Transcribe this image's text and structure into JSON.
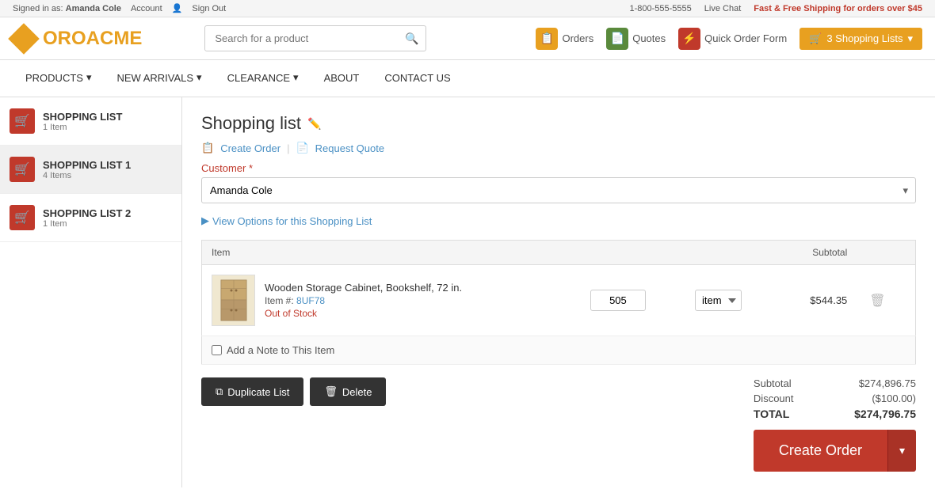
{
  "topbar": {
    "signed_in_label": "Signed in as:",
    "user_name": "Amanda Cole",
    "account_link": "Account",
    "sign_out_link": "Sign Out",
    "phone": "1-800-555-5555",
    "live_chat": "Live Chat",
    "promo": "Fast & Free Shipping for orders over $45"
  },
  "header": {
    "logo_text": "OROACME",
    "search_placeholder": "Search for a product",
    "actions": [
      {
        "id": "orders",
        "label": "Orders",
        "icon": "📋",
        "color": "orange"
      },
      {
        "id": "quotes",
        "label": "Quotes",
        "icon": "📄",
        "color": "green"
      },
      {
        "id": "quick-order",
        "label": "Quick Order Form",
        "icon": "⚡",
        "color": "red"
      }
    ],
    "shopping_lists_btn": "3 Shopping Lists"
  },
  "nav": {
    "items": [
      {
        "id": "products",
        "label": "PRODUCTS",
        "has_arrow": true
      },
      {
        "id": "new-arrivals",
        "label": "NEW ARRIVALS",
        "has_arrow": true
      },
      {
        "id": "clearance",
        "label": "CLEARANCE",
        "has_arrow": true
      },
      {
        "id": "about",
        "label": "ABOUT",
        "has_arrow": false
      },
      {
        "id": "contact-us",
        "label": "CONTACT US",
        "has_arrow": false
      }
    ]
  },
  "sidebar": {
    "items": [
      {
        "id": "list1",
        "title": "SHOPPING LIST",
        "count": "1 Item",
        "active": false
      },
      {
        "id": "list2",
        "title": "SHOPPING LIST 1",
        "count": "4 Items",
        "active": true
      },
      {
        "id": "list3",
        "title": "SHOPPING LIST 2",
        "count": "1 Item",
        "active": false
      }
    ]
  },
  "content": {
    "page_title": "Shopping list",
    "create_order_link": "Create Order",
    "request_quote_link": "Request Quote",
    "customer_label": "Customer",
    "customer_required": "*",
    "customer_value": "Amanda Cole",
    "view_options_label": "View Options for this Shopping List",
    "table": {
      "col_item": "Item",
      "col_subtotal": "Subtotal",
      "rows": [
        {
          "name": "Wooden Storage Cabinet, Bookshelf, 72 in.",
          "sku_label": "Item #:",
          "sku": "8UF78",
          "stock": "Out of Stock",
          "qty": "505",
          "unit": "item",
          "subtotal": "$544.35"
        }
      ]
    },
    "add_note_label": "Add a Note to This Item",
    "duplicate_btn": "Duplicate List",
    "delete_btn": "Delete",
    "summary": {
      "subtotal_label": "Subtotal",
      "subtotal_value": "$274,896.75",
      "discount_label": "Discount",
      "discount_value": "($100.00)",
      "total_label": "TOTAL",
      "total_value": "$274,796.75"
    },
    "create_order_btn": "Create Order"
  }
}
